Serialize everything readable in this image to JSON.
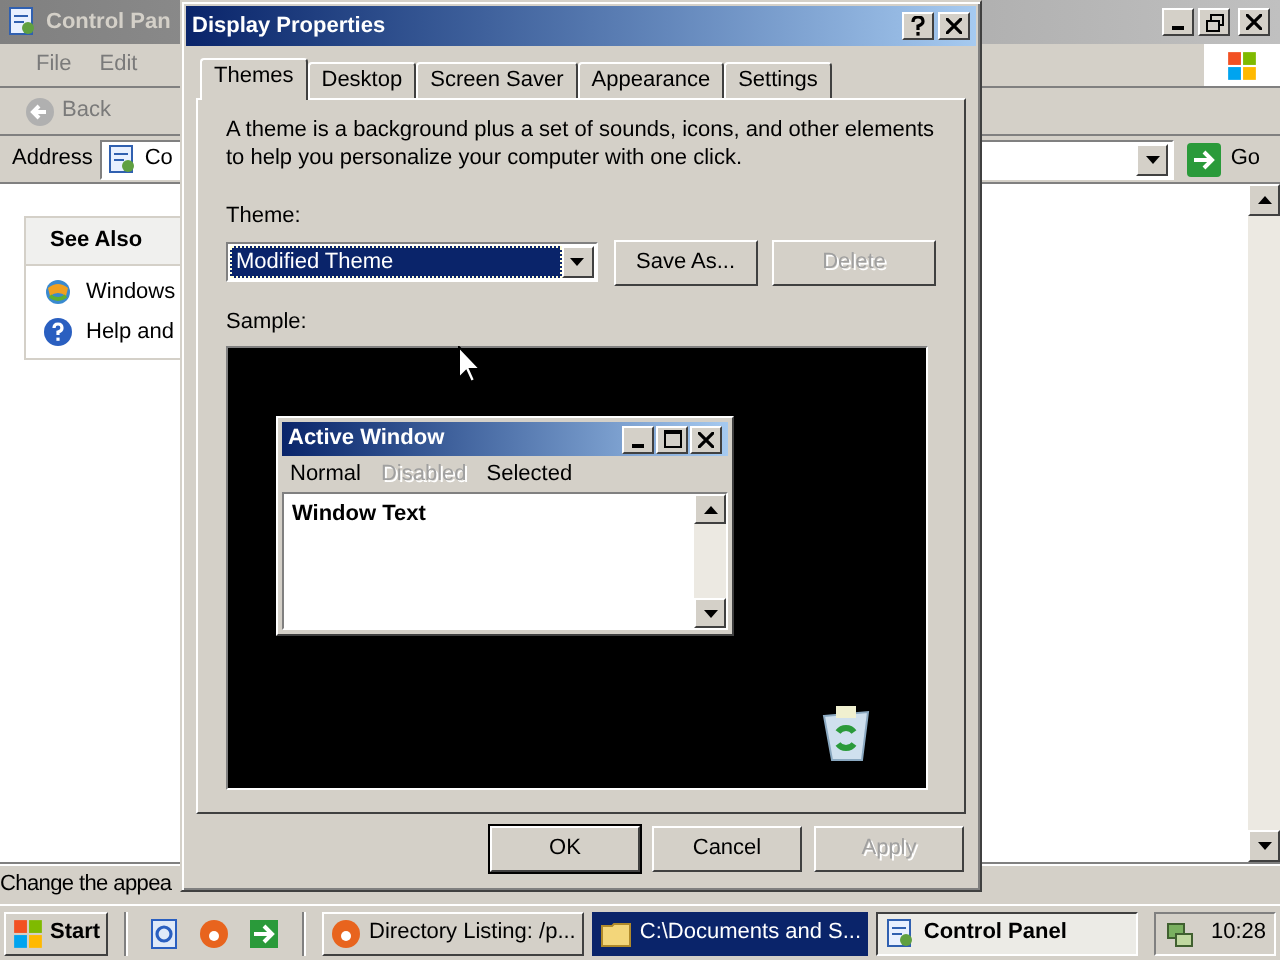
{
  "background_window": {
    "title": "Control Pan",
    "menu": [
      "File",
      "Edit"
    ],
    "back": "Back",
    "address": {
      "label": "Address",
      "value": "Co",
      "go": "Go"
    },
    "see_also": {
      "title": "See Also",
      "items": [
        "Windows",
        "Help and"
      ]
    },
    "status_bar": "Change the appea"
  },
  "dialog": {
    "title": "Display Properties",
    "tabs": [
      {
        "label": "Themes",
        "selected": true
      },
      {
        "label": "Desktop",
        "selected": false
      },
      {
        "label": "Screen Saver",
        "selected": false
      },
      {
        "label": "Appearance",
        "selected": false
      },
      {
        "label": "Settings",
        "selected": false
      }
    ],
    "description": "A theme is a background plus a set of sounds, icons, and other elements to help you personalize your computer with one click.",
    "theme_label": "Theme:",
    "theme_value": "Modified Theme",
    "theme_buttons": [
      {
        "label": "Save As...",
        "disabled": false
      },
      {
        "label": "Delete",
        "disabled": true
      }
    ],
    "sample_label": "Sample:",
    "sample": {
      "title": "Active Window",
      "menu": [
        {
          "label": "Normal",
          "kind": "normal"
        },
        {
          "label": "Disabled",
          "kind": "disabled"
        },
        {
          "label": "Selected",
          "kind": "selected"
        }
      ],
      "text": "Window Text"
    },
    "buttons": [
      {
        "label": "OK",
        "disabled": false
      },
      {
        "label": "Cancel",
        "disabled": false
      },
      {
        "label": "Apply",
        "disabled": true
      }
    ]
  },
  "taskbar": {
    "start": "Start",
    "tasks": [
      {
        "label": "Directory Listing: /p...",
        "kind": "normal"
      },
      {
        "label": "C:\\Documents and S...",
        "kind": "highlighted"
      },
      {
        "label": "Control Panel",
        "kind": "active"
      }
    ],
    "clock": "10:28"
  }
}
